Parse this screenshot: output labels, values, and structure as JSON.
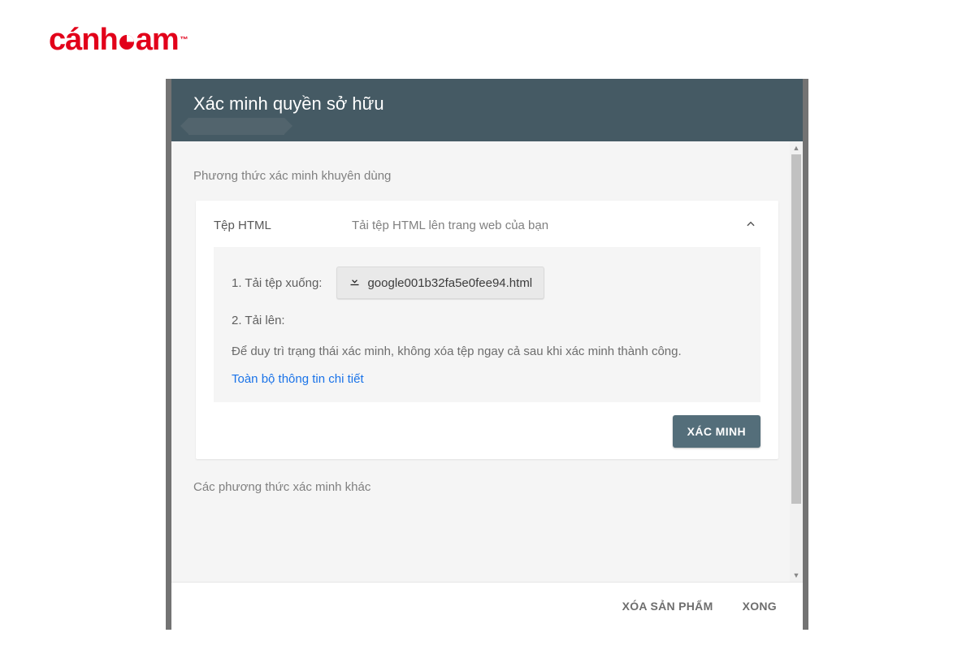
{
  "logo": {
    "brand_left": "cánh",
    "brand_right": "am",
    "tm": "™"
  },
  "dialog": {
    "title": "Xác minh quyền sở hữu",
    "recommended_label": "Phương thức xác minh khuyên dùng",
    "card": {
      "title": "Tệp HTML",
      "subtitle": "Tải tệp HTML lên trang web của bạn",
      "step1_label": "1. Tải tệp xuống:",
      "download_filename": "google001b32fa5e0fee94.html",
      "step2_label": "2. Tải lên:",
      "note": "Để duy trì trạng thái xác minh, không xóa tệp ngay cả sau khi xác minh thành công.",
      "details_link": "Toàn bộ thông tin chi tiết",
      "verify_button": "XÁC MINH"
    },
    "other_label": "Các phương thức xác minh khác",
    "footer": {
      "remove": "XÓA SẢN PHẨM",
      "done": "XONG"
    }
  }
}
